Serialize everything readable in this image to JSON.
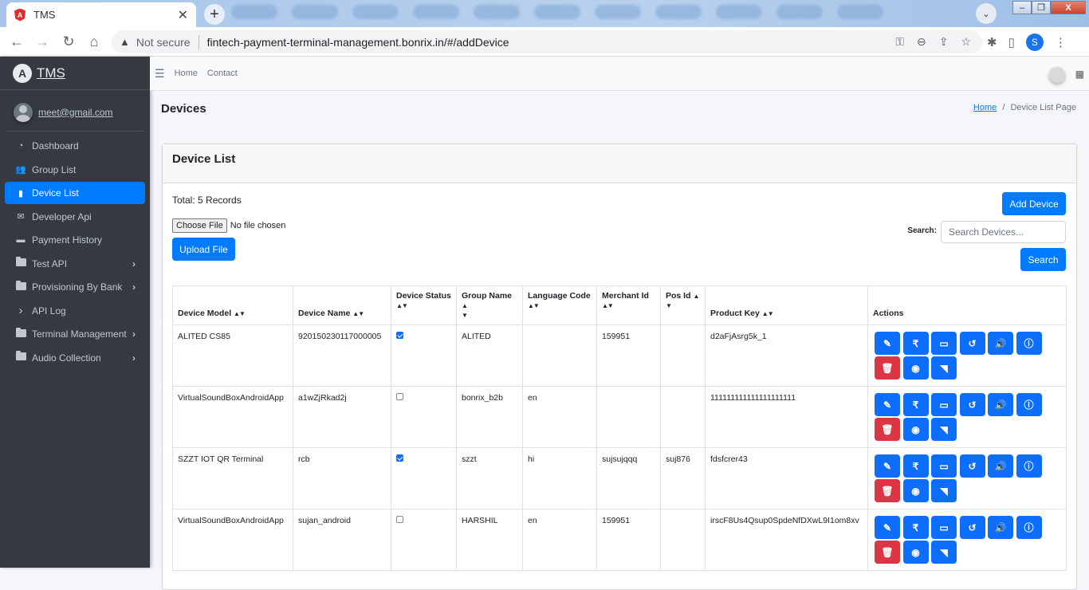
{
  "browser": {
    "tab_title": "TMS",
    "tab_favicon": "angular-icon",
    "new_tab": "+",
    "security_label": "Not secure",
    "url": "fintech-payment-terminal-management.bonrix.in/#/addDevice",
    "profile_initial": "S"
  },
  "sidebar": {
    "brand": "TMS",
    "user_email": "meet@gmail.com",
    "items": [
      {
        "label": "Dashboard",
        "icon": "tachometer-icon",
        "glyph": "◔",
        "active": false,
        "has_children": false
      },
      {
        "label": "Group List",
        "icon": "users-icon",
        "glyph": "👥",
        "active": false,
        "has_children": false
      },
      {
        "label": "Device List",
        "icon": "mobile-icon",
        "glyph": "▮",
        "active": true,
        "has_children": false
      },
      {
        "label": "Developer Api",
        "icon": "envelope-open-icon",
        "glyph": "✉",
        "active": false,
        "has_children": false
      },
      {
        "label": "Payment History",
        "icon": "credit-card-icon",
        "glyph": "▬",
        "active": false,
        "has_children": false
      },
      {
        "label": "Test API",
        "icon": "folder-icon",
        "glyph": "",
        "active": false,
        "has_children": true
      },
      {
        "label": "Provisioning By Bank",
        "icon": "folder-icon",
        "glyph": "",
        "active": false,
        "has_children": true
      },
      {
        "label": "API Log",
        "icon": "chevron-right-icon",
        "glyph": "›",
        "active": false,
        "has_children": false
      },
      {
        "label": "Terminal Management",
        "icon": "folder-icon",
        "glyph": "",
        "active": false,
        "has_children": true
      },
      {
        "label": "Audio Collection",
        "icon": "folder-icon",
        "glyph": "",
        "active": false,
        "has_children": true
      }
    ]
  },
  "topnav": {
    "home": "Home",
    "contact": "Contact"
  },
  "page": {
    "title": "Devices",
    "breadcrumb_home": "Home",
    "breadcrumb_sep": "/",
    "breadcrumb_current": "Device List Page"
  },
  "card": {
    "title": "Device List",
    "total": "Total: 5 Records",
    "choose_file": "Choose File",
    "no_file": "No file chosen",
    "upload_button": "Upload File",
    "add_button": "Add Device",
    "search_label": "Search:",
    "search_placeholder": "Search Devices...",
    "search_value": "",
    "search_button": "Search"
  },
  "table": {
    "columns": [
      "Device Model",
      "Device Name",
      "Device Status",
      "Group Name",
      "Language Code",
      "Merchant Id",
      "Pos Id",
      "Product Key",
      "Actions"
    ],
    "rows": [
      {
        "model": "ALITED CS85",
        "name": "920150230117000005",
        "status": true,
        "group": "ALITED",
        "lang": "",
        "merchant": "159951",
        "pos": "",
        "key": "d2aFjAsrg5k_1"
      },
      {
        "model": "VirtualSoundBoxAndroidApp",
        "name": "a1wZjRkad2j",
        "status": false,
        "group": "bonrix_b2b",
        "lang": "en",
        "merchant": "",
        "pos": "",
        "key": "111111111111111111111"
      },
      {
        "model": "SZZT IOT QR Terminal",
        "name": "rcb",
        "status": true,
        "group": "szzt",
        "lang": "hi",
        "merchant": "sujsujqqq",
        "pos": "suj876",
        "key": "fdsfcrer43"
      },
      {
        "model": "VirtualSoundBoxAndroidApp",
        "name": "sujan_android",
        "status": false,
        "group": "HARSHIL",
        "lang": "en",
        "merchant": "159951",
        "pos": "",
        "key": "irscF8Us4Qsup0SpdeNfDXwL9I1om8xv"
      }
    ],
    "actions": [
      {
        "name": "edit-icon",
        "glyph": "✎",
        "color": "#0d6efd"
      },
      {
        "name": "rupee-icon",
        "glyph": "₹",
        "color": "#0d6efd"
      },
      {
        "name": "desktop-icon",
        "glyph": "▭",
        "color": "#0d6efd"
      },
      {
        "name": "history-icon",
        "glyph": "↺",
        "color": "#0d6efd"
      },
      {
        "name": "volume-icon",
        "glyph": "🔊",
        "color": "#0d6efd"
      },
      {
        "name": "info-icon",
        "glyph": "ⓘ",
        "color": "#0d6efd"
      },
      {
        "name": "trash-icon",
        "glyph": "🗑",
        "color": "#dc3545"
      },
      {
        "name": "eye-icon",
        "glyph": "◉",
        "color": "#0d6efd"
      },
      {
        "name": "rss-icon",
        "glyph": "◥",
        "color": "#0d6efd"
      }
    ]
  }
}
